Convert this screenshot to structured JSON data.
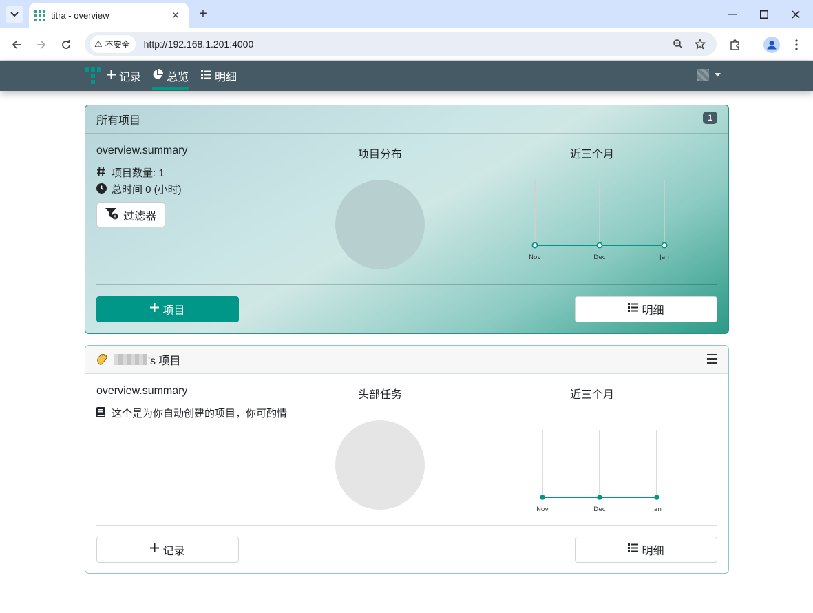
{
  "browser": {
    "tab_title": "titra - overview",
    "security_label": "不安全",
    "url": "http://192.168.1.201:4000"
  },
  "nav": {
    "items": [
      {
        "label": "记录",
        "icon": "plus-icon"
      },
      {
        "label": "总览",
        "icon": "pie-chart-icon",
        "active": true
      },
      {
        "label": "明细",
        "icon": "list-icon"
      }
    ]
  },
  "all_projects": {
    "header": "所有项目",
    "badge": "1",
    "summary_title": "overview.summary",
    "project_count": "项目数量: 1",
    "total_time": "总时间 0 (小时)",
    "filter_label": "过滤器",
    "distribution_title": "项目分布",
    "chart_title": "近三个月",
    "add_project_label": "项目",
    "details_label": "明细"
  },
  "user_project": {
    "header_suffix": "'s 项目",
    "summary_title": "overview.summary",
    "description": "这个是为你自动创建的项目，你可酌情",
    "top_tasks_title": "头部任务",
    "chart_title": "近三个月",
    "add_record_label": "记录",
    "details_label": "明细"
  },
  "chart_data": [
    {
      "type": "line",
      "title": "近三个月",
      "categories": [
        "Nov",
        "Dec",
        "Jan"
      ],
      "series": [
        {
          "values": [
            0,
            0,
            0
          ]
        }
      ]
    },
    {
      "type": "line",
      "title": "近三个月",
      "categories": [
        "Nov",
        "Dec",
        "Jan"
      ],
      "series": [
        {
          "values": [
            0,
            0,
            0
          ]
        }
      ]
    }
  ],
  "colors": {
    "primary": "#009688",
    "navbar": "#455a64",
    "tabstrip": "#d3e3fd"
  }
}
